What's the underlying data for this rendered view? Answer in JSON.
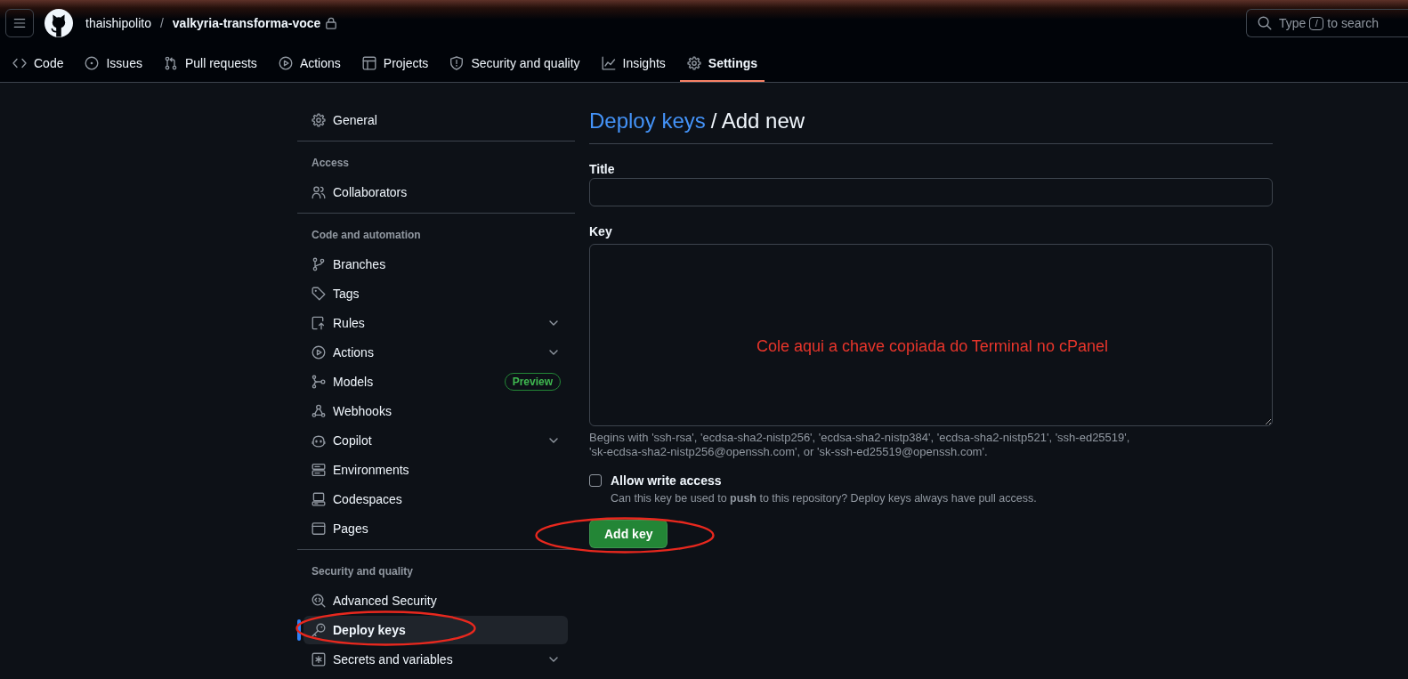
{
  "header": {
    "owner": "thaishipolito",
    "separator": "/",
    "repository": "valkyria-transforma-voce",
    "private": true,
    "search": {
      "hint": "Type",
      "shortcut": "/",
      "hint_end": "to search"
    }
  },
  "tabs": [
    {
      "label": "Code",
      "selected": false
    },
    {
      "label": "Issues",
      "selected": false
    },
    {
      "label": "Pull requests",
      "selected": false
    },
    {
      "label": "Actions",
      "selected": false
    },
    {
      "label": "Projects",
      "selected": false
    },
    {
      "label": "Security and quality",
      "selected": false
    },
    {
      "label": "Insights",
      "selected": false
    },
    {
      "label": "Settings",
      "selected": true
    }
  ],
  "sidebar": {
    "sections": [
      {
        "items": [
          {
            "label": "General",
            "selected": false,
            "expandable": false
          }
        ]
      },
      {
        "heading": "Access",
        "items": [
          {
            "label": "Collaborators",
            "selected": false,
            "expandable": false
          }
        ]
      },
      {
        "heading": "Code and automation",
        "items": [
          {
            "label": "Branches",
            "selected": false,
            "expandable": false
          },
          {
            "label": "Tags",
            "selected": false,
            "expandable": false
          },
          {
            "label": "Rules",
            "selected": false,
            "expandable": true
          },
          {
            "label": "Actions",
            "selected": false,
            "expandable": true
          },
          {
            "label": "Models",
            "selected": false,
            "expandable": false,
            "badge": "Preview"
          },
          {
            "label": "Webhooks",
            "selected": false,
            "expandable": false
          },
          {
            "label": "Copilot",
            "selected": false,
            "expandable": true
          },
          {
            "label": "Environments",
            "selected": false,
            "expandable": false
          },
          {
            "label": "Codespaces",
            "selected": false,
            "expandable": false
          },
          {
            "label": "Pages",
            "selected": false,
            "expandable": false
          }
        ]
      },
      {
        "heading": "Security and quality",
        "items": [
          {
            "label": "Advanced Security",
            "selected": false,
            "expandable": false
          },
          {
            "label": "Deploy keys",
            "selected": true,
            "expandable": false
          },
          {
            "label": "Secrets and variables",
            "selected": false,
            "expandable": true
          }
        ]
      }
    ]
  },
  "page": {
    "breadcrumb": "Deploy keys",
    "title": "/ Add new"
  },
  "form": {
    "title_field": {
      "label": "Title"
    },
    "key_field": {
      "label": "Key",
      "hint": "Begins with 'ssh-rsa', 'ecdsa-sha2-nistp256', 'ecdsa-sha2-nistp384', 'ecdsa-sha2-nistp521', 'ssh-ed25519', 'sk-ecdsa-sha2-nistp256@openssh.com', or 'sk-ssh-ed25519@openssh.com'."
    },
    "write_access": {
      "label": "Allow write access",
      "checked": false,
      "description": "Can this key be used to **push** to this repository? Deploy keys always have pull access."
    },
    "submit": {
      "label": "Add key"
    }
  },
  "annotation": {
    "note": "Cole aqui a chave copiada do Terminal no cPanel"
  }
}
